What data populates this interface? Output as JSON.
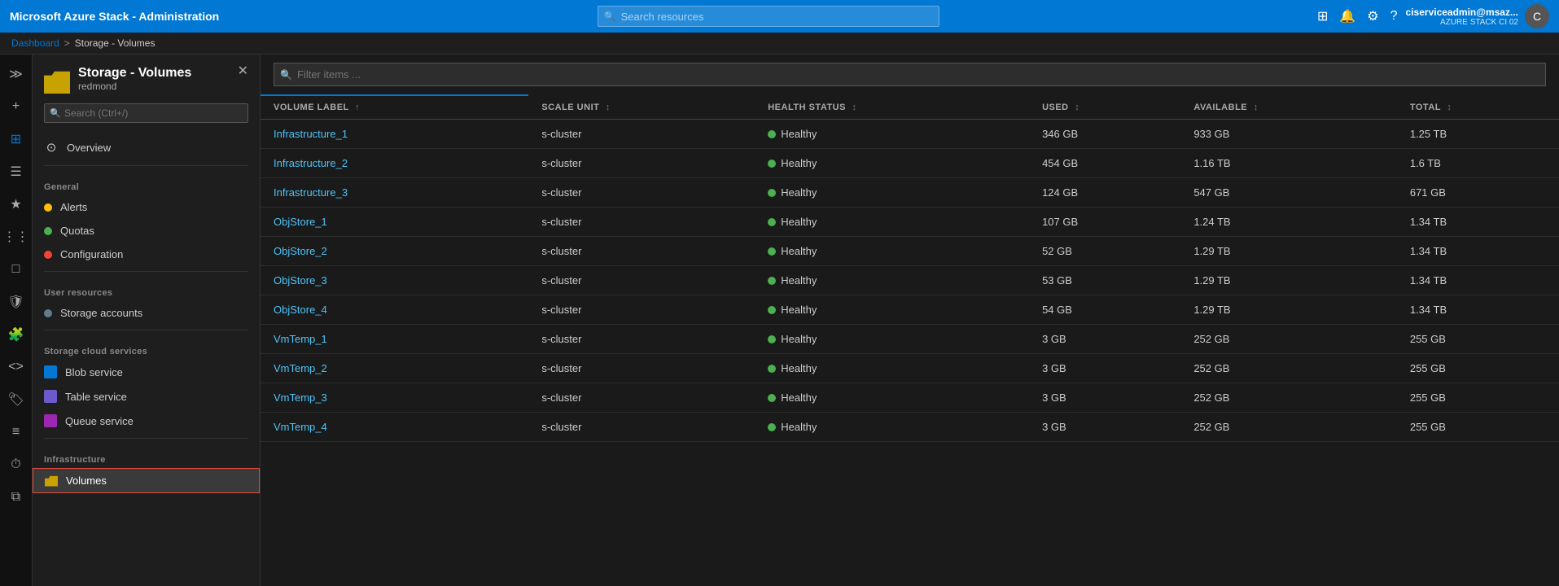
{
  "app": {
    "title": "Microsoft Azure Stack - Administration"
  },
  "topbar": {
    "search_placeholder": "Search resources",
    "username": "ciserviceadmin@msaz...",
    "tenant": "AZURE STACK CI 02",
    "avatar_initials": "C"
  },
  "breadcrumb": {
    "home": "Dashboard",
    "separator": ">",
    "current": "Storage - Volumes"
  },
  "sidebar": {
    "title": "Storage - Volumes",
    "subtitle": "redmond",
    "search_placeholder": "Search (Ctrl+/)",
    "overview_label": "Overview",
    "general_section": "General",
    "general_items": [
      {
        "id": "alerts",
        "label": "Alerts",
        "icon_color": "#ffc107"
      },
      {
        "id": "quotas",
        "label": "Quotas",
        "icon_color": "#4caf50"
      },
      {
        "id": "configuration",
        "label": "Configuration",
        "icon_color": "#e74c3c"
      }
    ],
    "user_resources_section": "User resources",
    "user_resources_items": [
      {
        "id": "storage-accounts",
        "label": "Storage accounts",
        "icon_color": "#607d8b"
      }
    ],
    "storage_cloud_section": "Storage cloud services",
    "storage_cloud_items": [
      {
        "id": "blob-service",
        "label": "Blob service",
        "icon_color": "#0078d4"
      },
      {
        "id": "table-service",
        "label": "Table service",
        "icon_color": "#6a5acd"
      },
      {
        "id": "queue-service",
        "label": "Queue service",
        "icon_color": "#9c27b0"
      }
    ],
    "infrastructure_section": "Infrastructure",
    "infrastructure_items": [
      {
        "id": "volumes",
        "label": "Volumes",
        "active": true
      }
    ]
  },
  "content": {
    "filter_placeholder": "Filter items ...",
    "columns": [
      {
        "id": "volume-label",
        "label": "VOLUME LABEL",
        "has_sort": true
      },
      {
        "id": "scale-unit",
        "label": "SCALE UNIT",
        "has_sort": true
      },
      {
        "id": "health-status",
        "label": "HEALTH STATUS",
        "has_sort": true
      },
      {
        "id": "used",
        "label": "USED",
        "has_sort": true
      },
      {
        "id": "available",
        "label": "AVAILABLE",
        "has_sort": true
      },
      {
        "id": "total",
        "label": "TOTAL",
        "has_sort": true
      }
    ],
    "rows": [
      {
        "volume_label": "Infrastructure_1",
        "scale_unit": "s-cluster",
        "health_status": "Healthy",
        "used": "346 GB",
        "available": "933 GB",
        "total": "1.25 TB"
      },
      {
        "volume_label": "Infrastructure_2",
        "scale_unit": "s-cluster",
        "health_status": "Healthy",
        "used": "454 GB",
        "available": "1.16 TB",
        "total": "1.6 TB"
      },
      {
        "volume_label": "Infrastructure_3",
        "scale_unit": "s-cluster",
        "health_status": "Healthy",
        "used": "124 GB",
        "available": "547 GB",
        "total": "671 GB"
      },
      {
        "volume_label": "ObjStore_1",
        "scale_unit": "s-cluster",
        "health_status": "Healthy",
        "used": "107 GB",
        "available": "1.24 TB",
        "total": "1.34 TB"
      },
      {
        "volume_label": "ObjStore_2",
        "scale_unit": "s-cluster",
        "health_status": "Healthy",
        "used": "52 GB",
        "available": "1.29 TB",
        "total": "1.34 TB"
      },
      {
        "volume_label": "ObjStore_3",
        "scale_unit": "s-cluster",
        "health_status": "Healthy",
        "used": "53 GB",
        "available": "1.29 TB",
        "total": "1.34 TB"
      },
      {
        "volume_label": "ObjStore_4",
        "scale_unit": "s-cluster",
        "health_status": "Healthy",
        "used": "54 GB",
        "available": "1.29 TB",
        "total": "1.34 TB"
      },
      {
        "volume_label": "VmTemp_1",
        "scale_unit": "s-cluster",
        "health_status": "Healthy",
        "used": "3 GB",
        "available": "252 GB",
        "total": "255 GB"
      },
      {
        "volume_label": "VmTemp_2",
        "scale_unit": "s-cluster",
        "health_status": "Healthy",
        "used": "3 GB",
        "available": "252 GB",
        "total": "255 GB"
      },
      {
        "volume_label": "VmTemp_3",
        "scale_unit": "s-cluster",
        "health_status": "Healthy",
        "used": "3 GB",
        "available": "252 GB",
        "total": "255 GB"
      },
      {
        "volume_label": "VmTemp_4",
        "scale_unit": "s-cluster",
        "health_status": "Healthy",
        "used": "3 GB",
        "available": "252 GB",
        "total": "255 GB"
      }
    ]
  }
}
